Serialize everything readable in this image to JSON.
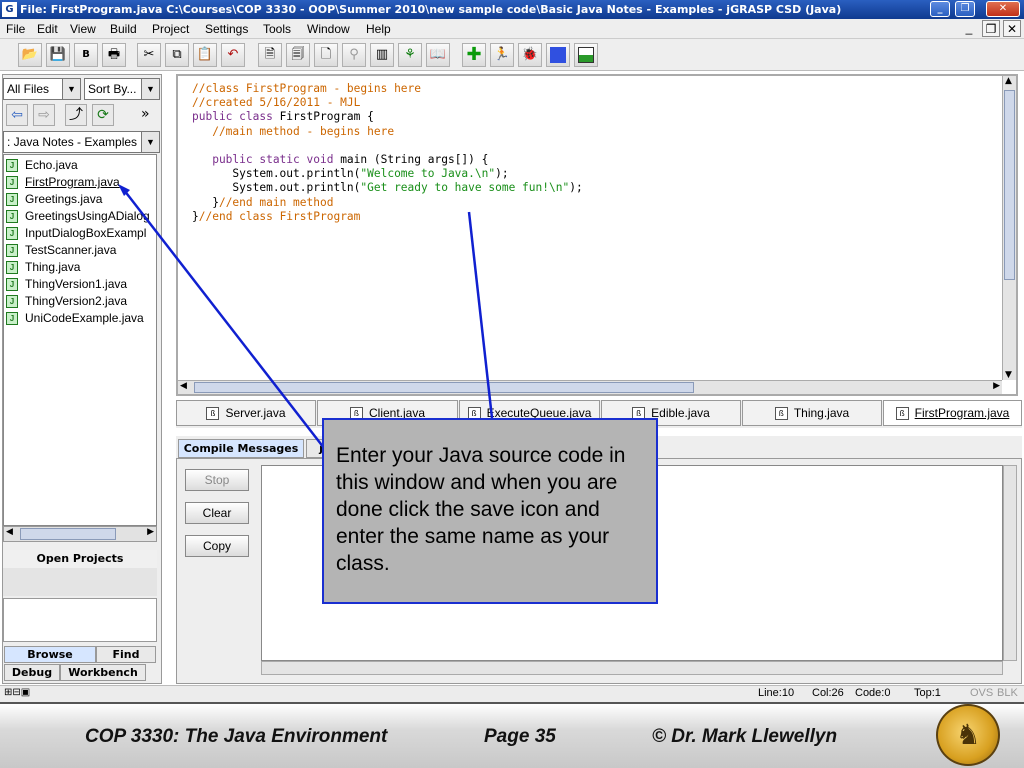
{
  "window": {
    "title": "File: FirstProgram.java  C:\\Courses\\COP 3330 - OOP\\Summer 2010\\new sample code\\Basic Java Notes - Examples - jGRASP CSD (Java)"
  },
  "menu": {
    "items": [
      "File",
      "Edit",
      "View",
      "Build",
      "Project",
      "Settings",
      "Tools",
      "Window",
      "Help"
    ]
  },
  "browser": {
    "filter": "All Files",
    "sort": "Sort By...",
    "folder": ": Java Notes - Examples",
    "files": [
      "Echo.java",
      "FirstProgram.java",
      "Greetings.java",
      "GreetingsUsingADialog",
      "InputDialogBoxExampl",
      "TestScanner.java",
      "Thing.java",
      "ThingVersion1.java",
      "ThingVersion2.java",
      "UniCodeExample.java"
    ],
    "open_projects": "Open Projects",
    "tabs": [
      "Browse",
      "Find",
      "Debug",
      "Workbench"
    ]
  },
  "editor": {
    "lines": [
      [
        {
          "t": "//class FirstProgram - begins here",
          "c": "c"
        }
      ],
      [
        {
          "t": "//created 5/16/2011 - MJL",
          "c": "c"
        }
      ],
      [
        {
          "t": "public class ",
          "c": "k"
        },
        {
          "t": "FirstProgram {",
          "c": "p"
        }
      ],
      [
        {
          "t": "   //main method - begins here",
          "c": "c"
        }
      ],
      [
        {
          "t": "",
          "c": "p"
        }
      ],
      [
        {
          "t": "   public static void ",
          "c": "k"
        },
        {
          "t": "main (String args[]) {",
          "c": "p"
        }
      ],
      [
        {
          "t": "      System.out.println(",
          "c": "p"
        },
        {
          "t": "\"Welcome to Java.\\n\"",
          "c": "s"
        },
        {
          "t": ");",
          "c": "p"
        }
      ],
      [
        {
          "t": "      System.out.println(",
          "c": "p"
        },
        {
          "t": "\"Get ready to have some fun!\\n\"",
          "c": "s"
        },
        {
          "t": ");",
          "c": "p"
        }
      ],
      [
        {
          "t": "   }",
          "c": "p"
        },
        {
          "t": "//end main method",
          "c": "c"
        }
      ],
      [
        {
          "t": "}",
          "c": "p"
        },
        {
          "t": "//end class FirstProgram",
          "c": "c"
        }
      ]
    ]
  },
  "file_tabs": [
    "Server.java",
    "Client.java",
    "ExecuteQueue.java",
    "Edible.java",
    "Thing.java",
    "FirstProgram.java"
  ],
  "messages": {
    "tabs": [
      "Compile Messages",
      "j"
    ],
    "buttons": [
      "Stop",
      "Clear",
      "Copy"
    ]
  },
  "status": {
    "line": "Line:10",
    "col": "Col:26",
    "code": "Code:0",
    "top": "Top:1",
    "ovs": "OVS",
    "blk": "BLK"
  },
  "callout": "Enter your Java source code in this window and when you are done click the save icon and enter the same name as your class.",
  "footer": {
    "course": "COP 3330:  The Java Environment",
    "page": "Page 35",
    "author": "© Dr. Mark Llewellyn"
  }
}
